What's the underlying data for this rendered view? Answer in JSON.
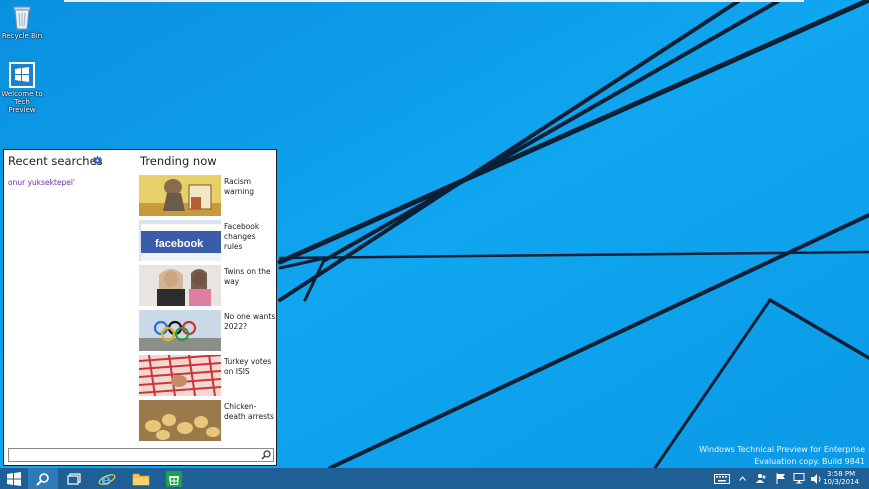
{
  "desktop": {
    "icons": [
      {
        "label": "Recycle Bin",
        "icon": "recycle-bin-icon"
      },
      {
        "label": "Welcome to Tech Preview",
        "icon": "windows-logo-icon"
      }
    ],
    "watermark": {
      "line1": "Windows Technical Preview for Enterprise",
      "line2": "Evaluation copy. Build 9841"
    }
  },
  "search_panel": {
    "recent_title": "Recent searches",
    "recent_items": [
      "onur yuksektepel'"
    ],
    "trending_title": "Trending now",
    "trending": [
      {
        "label": "Racism warning",
        "image": "cartoon-thumbnail"
      },
      {
        "label": "Facebook changes rules",
        "image": "facebook-sign-thumbnail"
      },
      {
        "label": "Twins on the way",
        "image": "couple-thumbnail"
      },
      {
        "label": "No one wants 2022?",
        "image": "olympic-rings-thumbnail"
      },
      {
        "label": "Turkey votes on ISIS",
        "image": "keffiyeh-thumbnail"
      },
      {
        "label": "Chicken-death arrests",
        "image": "chicks-thumbnail"
      }
    ],
    "search_value": "",
    "search_placeholder": ""
  },
  "taskbar": {
    "buttons": [
      "start-icon",
      "search-icon",
      "task-view-icon",
      "internet-explorer-icon",
      "file-explorer-icon",
      "store-icon"
    ],
    "tray": [
      "keyboard-icon",
      "chevron-up-icon",
      "people-icon",
      "flag-icon",
      "network-icon",
      "volume-icon"
    ],
    "clock_time": "3:58 PM",
    "clock_date": "10/3/2014"
  },
  "colors": {
    "wallpaper": "#0a98e8",
    "taskbar": "#1e5f95",
    "recent_link": "#6b2fa0",
    "gear": "#2b63b8"
  }
}
